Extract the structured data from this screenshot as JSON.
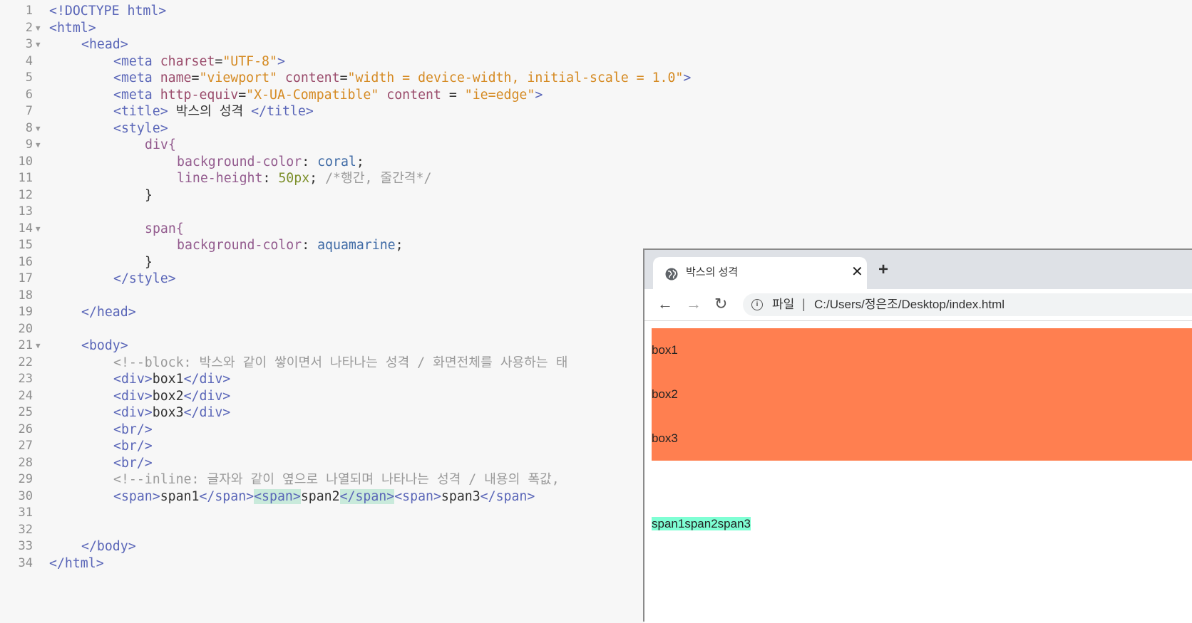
{
  "editor": {
    "lines": [
      {
        "n": "1"
      },
      {
        "n": "2"
      },
      {
        "n": "3"
      },
      {
        "n": "4"
      },
      {
        "n": "5"
      },
      {
        "n": "6"
      },
      {
        "n": "7"
      },
      {
        "n": "8"
      },
      {
        "n": "9"
      },
      {
        "n": "10"
      },
      {
        "n": "11"
      },
      {
        "n": "12"
      },
      {
        "n": "13"
      },
      {
        "n": "14"
      },
      {
        "n": "15"
      },
      {
        "n": "16"
      },
      {
        "n": "17"
      },
      {
        "n": "18"
      },
      {
        "n": "19"
      },
      {
        "n": "20"
      },
      {
        "n": "21"
      },
      {
        "n": "22"
      },
      {
        "n": "23"
      },
      {
        "n": "24"
      },
      {
        "n": "25"
      },
      {
        "n": "26"
      },
      {
        "n": "27"
      },
      {
        "n": "28"
      },
      {
        "n": "29"
      },
      {
        "n": "30"
      },
      {
        "n": "31"
      },
      {
        "n": "32"
      },
      {
        "n": "33"
      },
      {
        "n": "34"
      }
    ],
    "fold_glyph": "▼",
    "t": {
      "doctype": "<!DOCTYPE html>",
      "html_open": "<html>",
      "head_open": "<head>",
      "meta_open": "<meta ",
      "close_gt": ">",
      "charset_attr": "charset",
      "eq": "=",
      "eq_spaced": " = ",
      "space": " ",
      "charset_val": "\"UTF-8\"",
      "name_attr": "name",
      "viewport_val": "\"viewport\"",
      "content_attr": "content",
      "content_val": "\"width = device-width, initial-scale = 1.0\"",
      "httpequiv_attr": "http-equiv",
      "xua_val": "\"X-UA-Compatible\"",
      "ie_val": "\"ie=edge\"",
      "title_open": "<title>",
      "title_text": " 박스의 성격 ",
      "title_close": "</title>",
      "style_open": "<style>",
      "div_sel": "div{",
      "bgc_prop": "background-color",
      "colon": ": ",
      "coral_val": "coral",
      "semi": ";",
      "lh_prop": "line-height",
      "lh_val": "50px",
      "lh_comment": " /*행간, 줄간격*/",
      "brace_close": "}",
      "span_sel": "span{",
      "aqua_val": "aquamarine",
      "style_close": "</style>",
      "head_close": "</head>",
      "body_open": "<body>",
      "comment_block": "<!--block: 박스와 같이 쌓이면서 나타나는 성격 / 화면전체를 사용하는 태",
      "div_open": "<div>",
      "div_close": "</div>",
      "box1": "box1",
      "box2": "box2",
      "box3": "box3",
      "br": "<br/>",
      "comment_inline": "<!--inline: 글자와 같이 옆으로 나열되며 나타나는 성격 / 내용의 폭값,",
      "span_open": "<span>",
      "span_close": "</span>",
      "span1": "span1",
      "span2": "span2",
      "span3": "span3",
      "body_close": "</body>",
      "html_close": "</html>"
    }
  },
  "browser": {
    "tab_title": "박스의 성격",
    "tab_close": "✕",
    "new_tab": "+",
    "nav": {
      "back": "←",
      "forward": "→",
      "reload": "↻"
    },
    "info_icon": "i",
    "scheme_label": "파일",
    "separator": "|",
    "url": "C:/Users/정은조/Desktop/index.html",
    "page": {
      "boxes": [
        "box1",
        "box2",
        "box3"
      ],
      "spans": [
        "span1",
        "span2",
        "span3"
      ]
    }
  },
  "colors": {
    "div_background": "coral",
    "span_background": "aquamarine",
    "tag": "#5a66b8",
    "string": "#d58a22",
    "attribute": "#9a4b6b",
    "comment": "#9a9a9a"
  }
}
